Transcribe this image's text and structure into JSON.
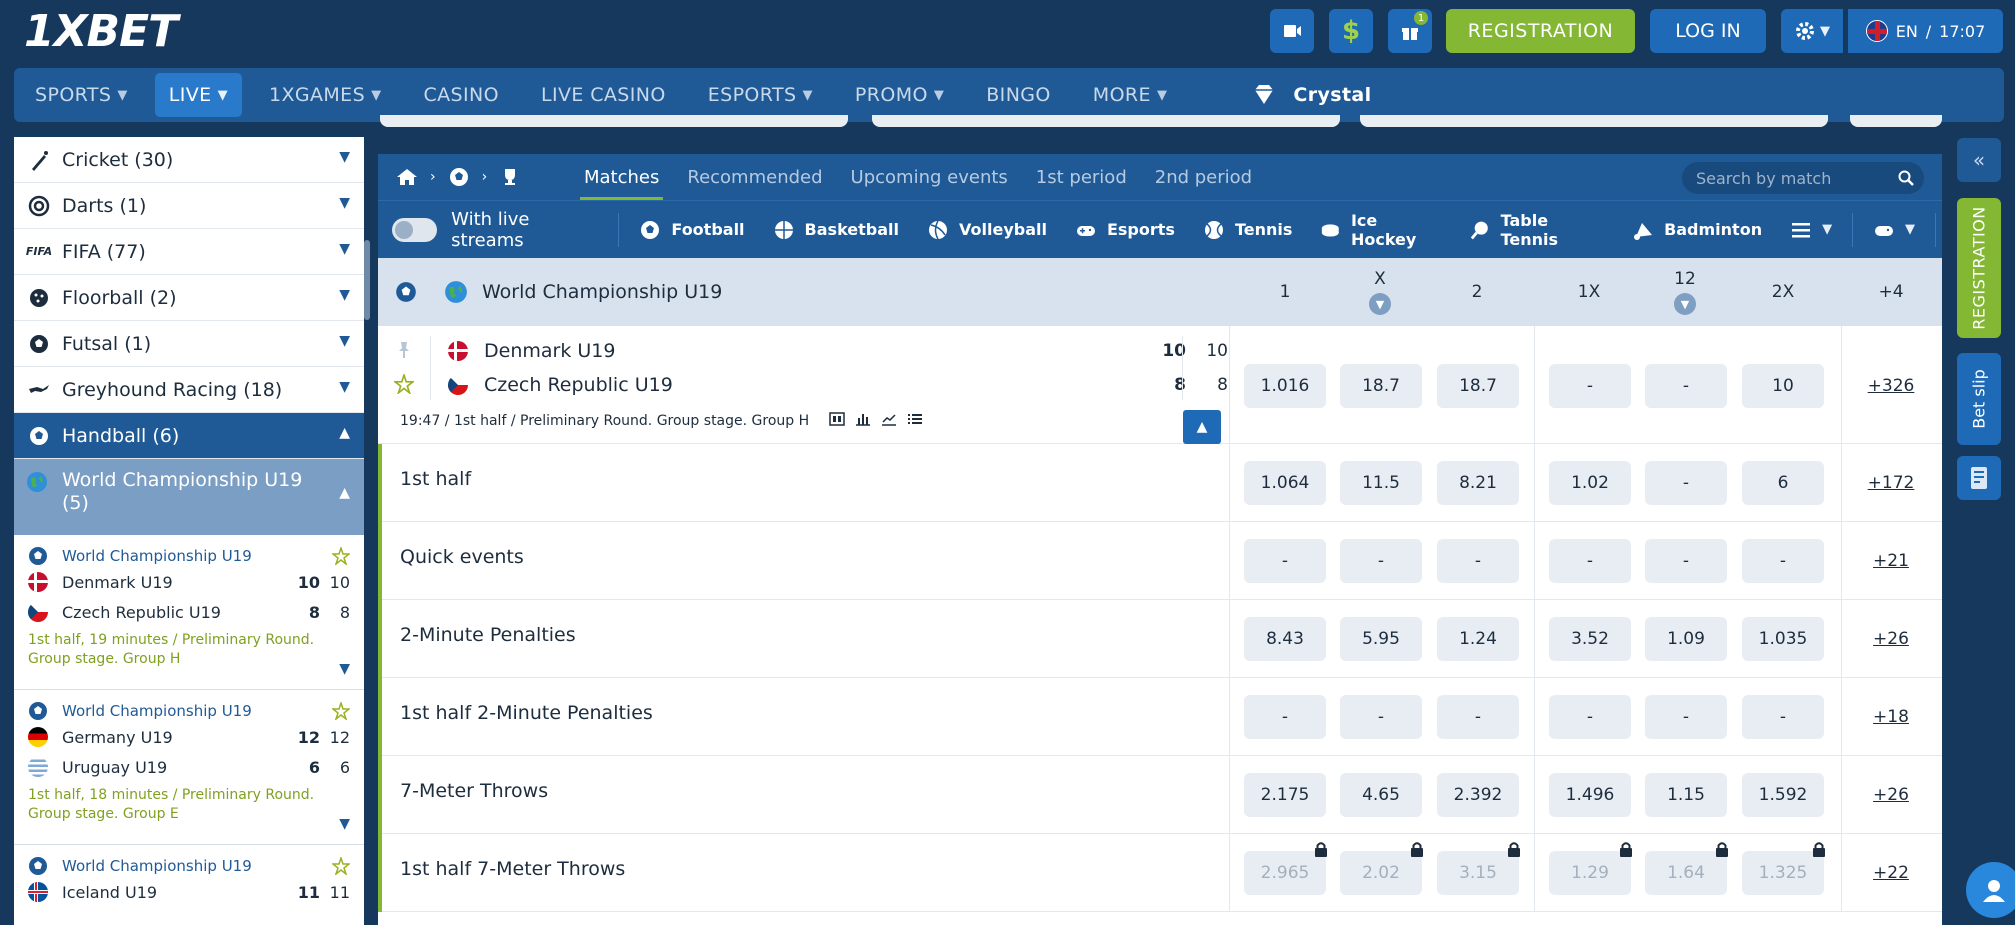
{
  "header": {
    "logo": "1XBET",
    "gift_badge": "1",
    "register_label": "REGISTRATION",
    "login_label": "LOG IN",
    "lang": "EN",
    "lang_sep": "/",
    "time": "17:07"
  },
  "nav": [
    {
      "label": "SPORTS",
      "dropdown": true
    },
    {
      "label": "LIVE",
      "dropdown": true,
      "active": true
    },
    {
      "label": "1XGAMES",
      "dropdown": true
    },
    {
      "label": "CASINO"
    },
    {
      "label": "LIVE CASINO"
    },
    {
      "label": "ESPORTS",
      "dropdown": true
    },
    {
      "label": "PROMO",
      "dropdown": true
    },
    {
      "label": "BINGO"
    },
    {
      "label": "MORE",
      "dropdown": true
    },
    {
      "label": "Crystal"
    }
  ],
  "sidebar": {
    "categories": [
      {
        "label": "Cricket (30)",
        "icon": "cricket-icon"
      },
      {
        "label": "Darts (1)",
        "icon": "darts-icon"
      },
      {
        "label": "FIFA (77)",
        "icon": "fifa-icon"
      },
      {
        "label": "Floorball (2)",
        "icon": "floorball-icon"
      },
      {
        "label": "Futsal (1)",
        "icon": "futsal-icon"
      },
      {
        "label": "Greyhound Racing (18)",
        "icon": "greyhound-icon"
      },
      {
        "label": "Handball (6)",
        "icon": "handball-icon",
        "active": true
      }
    ],
    "fifa_text": "FIFA",
    "sub": {
      "label": "World Championship U19 (5)"
    },
    "matches": [
      {
        "league": "World Championship U19",
        "t1": "Denmark U19",
        "t1s": "10",
        "t1p": "10",
        "t2": "Czech Republic U19",
        "t2s": "8",
        "t2p": "8",
        "info": "1st half, 19 minutes / Preliminary Round. Group stage. Group H"
      },
      {
        "league": "World Championship U19",
        "t1": "Germany U19",
        "t1s": "12",
        "t1p": "12",
        "t2": "Uruguay U19",
        "t2s": "6",
        "t2p": "6",
        "info": "1st half, 18 minutes / Preliminary Round. Group stage. Group E"
      },
      {
        "league": "World Championship U19",
        "t1": "Iceland U19",
        "t1s": "11",
        "t1p": "11"
      }
    ]
  },
  "panel": {
    "tabs": [
      "Matches",
      "Recommended",
      "Upcoming events",
      "1st period",
      "2nd period"
    ],
    "search_placeholder": "Search by match",
    "live_streams_label": "With live streams",
    "sports": [
      "Football",
      "Basketball",
      "Volleyball",
      "Esports",
      "Tennis",
      "Ice Hockey",
      "Table Tennis",
      "Badminton"
    ],
    "league": "World Championship U19",
    "columns": [
      "1",
      "X",
      "2",
      "1X",
      "12",
      "2X",
      "+4"
    ],
    "match": {
      "team1": "Denmark U19",
      "team1_score": "10",
      "team1_period": "10",
      "team2": "Czech Republic U19",
      "team2_score": "8",
      "team2_period": "8",
      "info": "19:47 / 1st half / Preliminary Round. Group stage. Group H",
      "odds": [
        "1.016",
        "18.7",
        "18.7",
        "-",
        "-",
        "10"
      ],
      "more": "+326"
    },
    "markets": [
      {
        "name": "1st half",
        "odds": [
          "1.064",
          "11.5",
          "8.21",
          "1.02",
          "-",
          "6"
        ],
        "more": "+172"
      },
      {
        "name": "Quick events",
        "odds": [
          "-",
          "-",
          "-",
          "-",
          "-",
          "-"
        ],
        "more": "+21"
      },
      {
        "name": "2-Minute Penalties",
        "odds": [
          "8.43",
          "5.95",
          "1.24",
          "3.52",
          "1.09",
          "1.035"
        ],
        "more": "+26"
      },
      {
        "name": "1st half 2-Minute Penalties",
        "odds": [
          "-",
          "-",
          "-",
          "-",
          "-",
          "-"
        ],
        "more": "+18"
      },
      {
        "name": "7-Meter Throws",
        "odds": [
          "2.175",
          "4.65",
          "2.392",
          "1.496",
          "1.15",
          "1.592"
        ],
        "more": "+26"
      },
      {
        "name": "1st half 7-Meter Throws",
        "odds": [
          "2.965",
          "2.02",
          "3.15",
          "1.29",
          "1.64",
          "1.325"
        ],
        "more": "+22",
        "locked": true
      }
    ]
  },
  "rail": {
    "registration": "REGISTRATION",
    "bet_slip": "Bet slip"
  },
  "colors": {
    "brand_navy": "#16385d",
    "nav_blue": "#1f5a96",
    "accent_blue": "#1f6ab6",
    "accent_green": "#84b734",
    "odds_bg": "#e8edf3"
  }
}
